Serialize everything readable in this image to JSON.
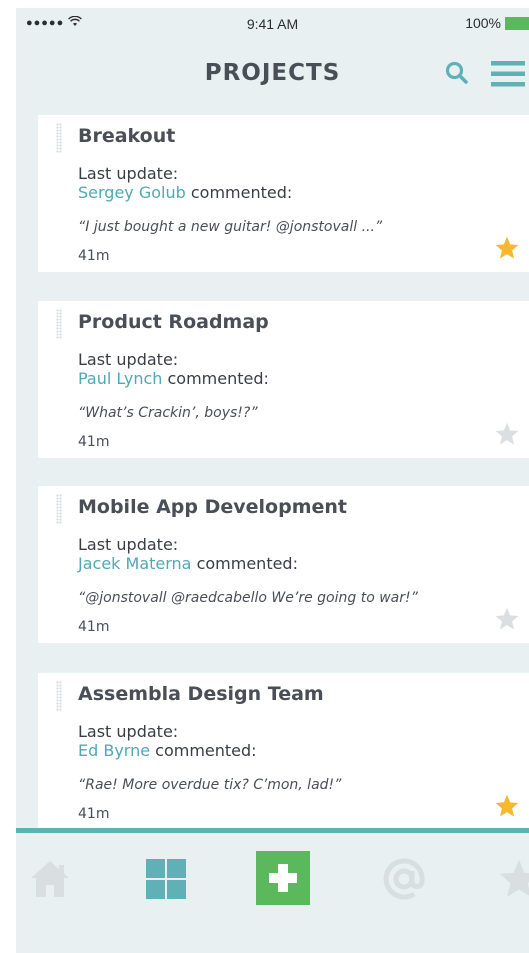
{
  "status_bar": {
    "signal": "●●●●●",
    "time": "9:41 AM",
    "battery": "100%",
    "battery_color": "#5cb85c"
  },
  "header": {
    "title": "PROJECTS",
    "search_icon": "search-icon",
    "menu_icon": "hamburger-menu-icon",
    "accent_color": "#5fb1b6"
  },
  "projects": [
    {
      "title": "Breakout",
      "update_label": "Last update:",
      "author": "Sergey Golub",
      "action": " commented:",
      "quote": "“I just bought a new guitar! @jonstovall ...”",
      "time": "41m",
      "starred": true
    },
    {
      "title": "Product Roadmap",
      "update_label": "Last update:",
      "author": "Paul Lynch",
      "action": " commented:",
      "quote": "“What’s Crackin’, boys!?”",
      "time": "41m",
      "starred": false
    },
    {
      "title": "Mobile App Development",
      "update_label": "Last update:",
      "author": "Jacek Materna",
      "action": " commented:",
      "quote": "“@jonstovall @raedcabello We’re going to war!”",
      "time": "41m",
      "starred": false
    },
    {
      "title": "Assembla Design Team",
      "update_label": "Last update:",
      "author": "Ed Byrne",
      "action": " commented:",
      "quote": "“Rae! More overdue tix? C’mon, lad!”",
      "time": "41m",
      "starred": true
    }
  ],
  "colors": {
    "star_active": "#f5b82e",
    "star_inactive": "#dcdfe1",
    "link": "#4fa8b5",
    "add_button": "#5cb85c",
    "grid_tab": "#5fb1b6",
    "inactive_tab": "#d9dee0"
  },
  "tab_bar": {
    "items": [
      "home-icon",
      "grid-icon",
      "add-icon",
      "at-mention-icon",
      "star-icon"
    ]
  }
}
